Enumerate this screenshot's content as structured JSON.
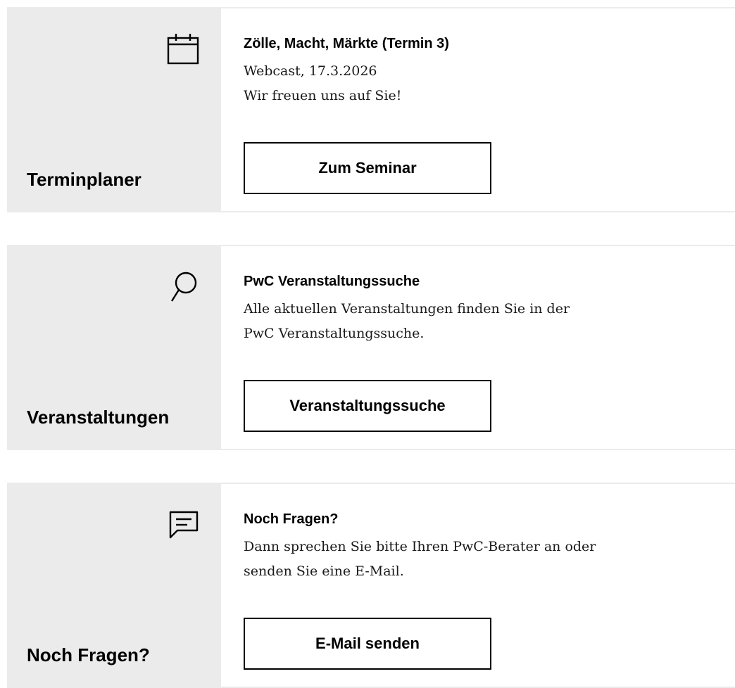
{
  "cards": [
    {
      "side_label": "Terminplaner",
      "icon": "calendar-icon",
      "title": "Zölle, Macht, Märkte (Termin 3)",
      "lines": [
        "Webcast, 17.3.2026",
        "Wir freuen uns auf Sie!"
      ],
      "button_label": "Zum Seminar"
    },
    {
      "side_label": "Veranstaltungen",
      "icon": "search-icon",
      "title": "PwC Veranstaltungssuche",
      "lines": [
        "Alle aktuellen Veranstaltungen finden Sie in der",
        "PwC Veranstaltungssuche."
      ],
      "button_label": "Veranstaltungssuche"
    },
    {
      "side_label": "Noch Fragen?",
      "icon": "chat-icon",
      "title": "Noch Fragen?",
      "lines": [
        "Dann sprechen Sie bitte Ihren PwC-Berater an oder",
        "senden Sie eine E-Mail."
      ],
      "button_label": "E-Mail senden"
    }
  ],
  "colors": {
    "side_background": "#ebebeb",
    "border": "#ebebeb",
    "text": "#000000"
  }
}
